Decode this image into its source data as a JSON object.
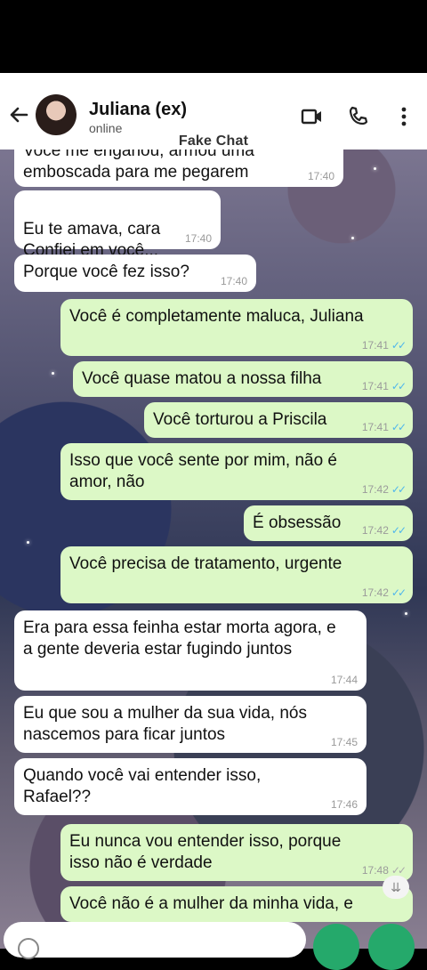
{
  "header": {
    "contact_name": "Juliana (ex)",
    "status": "online",
    "icons": [
      "back-arrow-icon",
      "video-call-icon",
      "phone-icon",
      "more-vert-icon"
    ]
  },
  "watermark": "Fake Chat",
  "colors": {
    "incoming_bubble": "#ffffff",
    "outgoing_bubble": "#dcf8c6",
    "read_ticks": "#4fb6ec"
  },
  "messages": [
    {
      "dir": "in",
      "text": "Você me enganou, armou uma emboscada para me pegarem",
      "time": "17:40"
    },
    {
      "dir": "in",
      "text": "Eu te amava, cara\nConfiei em você...",
      "time": "17:40"
    },
    {
      "dir": "in",
      "text": "Porque você fez isso?",
      "time": "17:40"
    },
    {
      "dir": "out",
      "text": "Você é completamente maluca, Juliana",
      "time": "17:41"
    },
    {
      "dir": "out",
      "text": "Você quase matou a nossa filha",
      "time": "17:41"
    },
    {
      "dir": "out",
      "text": "Você torturou a Priscila",
      "time": "17:41"
    },
    {
      "dir": "out",
      "text": "Isso que você sente por mim, não é amor, não",
      "time": "17:42"
    },
    {
      "dir": "out",
      "text": "É obsessão",
      "time": "17:42"
    },
    {
      "dir": "out",
      "text": "Você precisa de tratamento, urgente",
      "time": "17:42"
    },
    {
      "dir": "in",
      "text": "Era para essa feinha estar morta agora, e a gente deveria estar fugindo juntos",
      "time": "17:44"
    },
    {
      "dir": "in",
      "text": "Eu que sou a mulher da sua vida, nós nascemos para ficar juntos",
      "time": "17:45"
    },
    {
      "dir": "in",
      "text": "Quando você vai entender isso, Rafael??",
      "time": "17:46"
    },
    {
      "dir": "out",
      "text": "Eu nunca vou entender isso, porque isso não é verdade",
      "time": "17:48"
    },
    {
      "dir": "out",
      "text": "Você não é a mulher da minha vida, e",
      "time": ""
    }
  ],
  "scroll_down_icon": "double-chevron-down-icon",
  "input": {
    "emoji_icon": "emoji-icon",
    "send_icon": "send-icon"
  }
}
